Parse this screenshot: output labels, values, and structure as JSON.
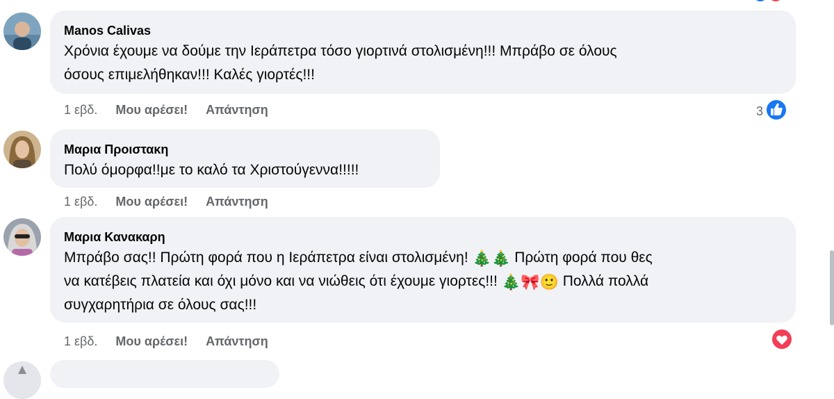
{
  "comments": [
    {
      "author": "Manos Calivas",
      "lines": [
        "Χρόνια έχουμε να δούμε την Ιεράπετρα τόσο γιορτινά στολισμένη!!! Μπράβο σε όλους",
        "όσους επιμελήθηκαν!!! Καλές γιορτές!!!"
      ],
      "time": "1 εβδ.",
      "like_label": "Μου αρέσει!",
      "reply_label": "Απάντηση",
      "reaction_count": "3",
      "reaction_icon": "like-icon"
    },
    {
      "author": "Μαρια Προιστακη",
      "lines": [
        "Πολύ όμορφα!!με το καλό τα Χριστούγεννα!!!!!"
      ],
      "time": "1 εβδ.",
      "like_label": "Μου αρέσει!",
      "reply_label": "Απάντηση"
    },
    {
      "author": "Μαρια Κανακαρη",
      "line1_a": "Μπράβο σας!! Πρώτη φορά που η Ιεράπετρα είναι στολισμένη!",
      "line1_b": "Πρώτη φορά που θες",
      "line2_a": "να κατέβεις πλατεία και όχι μόνο και να νιώθεις ότι έχουμε γιορτες!!!",
      "line2_b": "Πολλά πολλά",
      "line3": "συγχαρητήρια σε όλους σας!!!",
      "emoji": {
        "tree": "🎄",
        "ribbon": "🎀",
        "smile": "🙂"
      },
      "time": "1 εβδ.",
      "like_label": "Μου αρέσει!",
      "reply_label": "Απάντηση",
      "reaction_icon": "love-icon"
    }
  ],
  "colors": {
    "like_blue": "#1877f2",
    "love_red": "#f33e58",
    "bubble_bg": "#f0f2f5",
    "meta_gray": "#65676b"
  }
}
